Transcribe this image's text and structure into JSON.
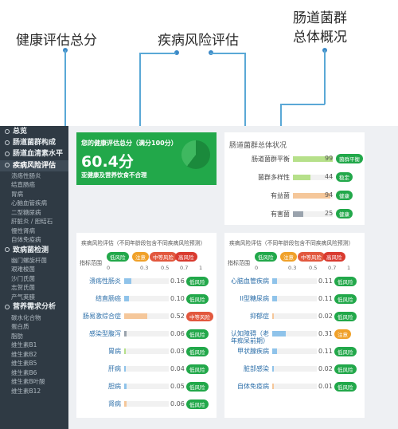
{
  "callouts": {
    "health": "健康评估总分",
    "risk": "疾病风险评估",
    "flora_line1": "肠道菌群",
    "flora_line2": "总体概况"
  },
  "sidebar": {
    "items": [
      {
        "label": "总览",
        "type": "head"
      },
      {
        "label": "肠道菌群构成",
        "type": "head"
      },
      {
        "label": "肠道血清素水平",
        "type": "head"
      },
      {
        "label": "疾病风险评估",
        "type": "head",
        "active": true
      },
      {
        "label": "溃疡性肠炎",
        "type": "sub"
      },
      {
        "label": "结直肠癌",
        "type": "sub"
      },
      {
        "label": "胃病",
        "type": "sub"
      },
      {
        "label": "心脑血管疾病",
        "type": "sub"
      },
      {
        "label": "二型糖尿病",
        "type": "sub"
      },
      {
        "label": "肝脏炎 / 胆结石",
        "type": "sub"
      },
      {
        "label": "慢性肾病",
        "type": "sub"
      },
      {
        "label": "自体免疫病",
        "type": "sub"
      },
      {
        "label": "致病菌检测",
        "type": "head"
      },
      {
        "label": "幽门螺旋杆菌",
        "type": "sub"
      },
      {
        "label": "艰难梭菌",
        "type": "sub"
      },
      {
        "label": "沙门氏菌",
        "type": "sub"
      },
      {
        "label": "志贺氏菌",
        "type": "sub"
      },
      {
        "label": "产气荚膜",
        "type": "sub"
      },
      {
        "label": "营养需求分析",
        "type": "head"
      },
      {
        "label": "碳水化合物",
        "type": "sub"
      },
      {
        "label": "蛋白质",
        "type": "sub"
      },
      {
        "label": "脂肪",
        "type": "sub"
      },
      {
        "label": "维生素B1",
        "type": "sub"
      },
      {
        "label": "维生素B2",
        "type": "sub"
      },
      {
        "label": "维生素B5",
        "type": "sub"
      },
      {
        "label": "维生素B6",
        "type": "sub"
      },
      {
        "label": "维生素B叶酸",
        "type": "sub"
      },
      {
        "label": "维生素B12",
        "type": "sub"
      }
    ]
  },
  "health_card": {
    "title": "您的健康评估总分（满分100分）",
    "score": "60.4分",
    "note": "亚健康及营养饮食不合理",
    "score_fraction": 0.604
  },
  "flora_card": {
    "title": "肠道菌群总体状况",
    "rows": [
      {
        "label": "肠道菌群平衡",
        "value": "99",
        "fraction": 0.99,
        "color": "#b6e08a",
        "badge": "菌群平衡",
        "level": "low"
      },
      {
        "label": "菌群多样性",
        "value": "44",
        "fraction": 0.44,
        "color": "#b6e08a",
        "badge": "稳定",
        "level": "low"
      },
      {
        "label": "有益菌",
        "value": "94",
        "fraction": 0.94,
        "color": "#f5c79a",
        "badge": "健康",
        "level": "low"
      },
      {
        "label": "有害菌",
        "value": "25",
        "fraction": 0.25,
        "color": "#9aa3ad",
        "badge": "健康",
        "level": "low"
      }
    ]
  },
  "risk_card_left": {
    "title": "疾病风险评估（不同年龄段包含不同疾病风险预测）",
    "range_label": "指标范围",
    "legend": [
      "低风险",
      "注意",
      "中等风险",
      "高风险"
    ],
    "ticks": [
      "0",
      "0.3",
      "0.5",
      "0.7",
      "1"
    ],
    "rows": [
      {
        "label": "溃疡性肠炎",
        "value": "0.16",
        "fraction": 0.16,
        "color": "#8fc3ea",
        "badge": "低风险",
        "level": "low"
      },
      {
        "label": "结直肠癌",
        "value": "0.10",
        "fraction": 0.1,
        "color": "#8fc3ea",
        "badge": "低风险",
        "level": "low"
      },
      {
        "label": "肠易激综合症",
        "value": "0.52",
        "fraction": 0.52,
        "color": "#f5c79a",
        "badge": "中等风险",
        "level": "midhigh"
      },
      {
        "label": "感染型腹泻",
        "value": "0.06",
        "fraction": 0.06,
        "color": "#9aa3ad",
        "badge": "低风险",
        "level": "low"
      },
      {
        "label": "胃病",
        "value": "0.03",
        "fraction": 0.03,
        "color": "#b6e08a",
        "badge": "低风险",
        "level": "low"
      },
      {
        "label": "肝病",
        "value": "0.04",
        "fraction": 0.04,
        "color": "#8fc3ea",
        "badge": "低风险",
        "level": "low"
      },
      {
        "label": "胆病",
        "value": "0.05",
        "fraction": 0.05,
        "color": "#8fc3ea",
        "badge": "低风险",
        "level": "low"
      },
      {
        "label": "肾病",
        "value": "0.06",
        "fraction": 0.06,
        "color": "#f5c79a",
        "badge": "低风险",
        "level": "low"
      }
    ]
  },
  "risk_card_right": {
    "title": "疾病风险评估（不同年龄段包含不同疾病风险预测）",
    "range_label": "指标范围",
    "legend": [
      "低风险",
      "注意",
      "中等风险",
      "高风险"
    ],
    "ticks": [
      "0",
      "0.3",
      "0.5",
      "0.7",
      "1"
    ],
    "rows": [
      {
        "label": "心脑血管疾病",
        "value": "0.11",
        "fraction": 0.11,
        "color": "#8fc3ea",
        "badge": "低风险",
        "level": "low"
      },
      {
        "label": "II型糖尿病",
        "value": "0.11",
        "fraction": 0.11,
        "color": "#8fc3ea",
        "badge": "低风险",
        "level": "low"
      },
      {
        "label": "抑郁症",
        "value": "0.02",
        "fraction": 0.02,
        "color": "#f5c79a",
        "badge": "低风险",
        "level": "low"
      },
      {
        "label": "认知障碍（老年痴呆前期）",
        "value": "0.31",
        "fraction": 0.31,
        "color": "#8fc3ea",
        "badge": "注意",
        "level": "mid"
      },
      {
        "label": "甲状腺疾病",
        "value": "0.11",
        "fraction": 0.11,
        "color": "#8fc3ea",
        "badge": "低风险",
        "level": "low"
      },
      {
        "label": "脏部感染",
        "value": "0.02",
        "fraction": 0.02,
        "color": "#8fc3ea",
        "badge": "低风险",
        "level": "low"
      },
      {
        "label": "自体免疫病",
        "value": "0.01",
        "fraction": 0.01,
        "color": "#f5c79a",
        "badge": "低风险",
        "level": "low"
      }
    ]
  },
  "colors": {
    "sidebar_bg": "#2f3a44",
    "accent_green": "#22a84a",
    "callout_line": "#5aa8d6",
    "label_blue": "#2b6ea8"
  }
}
